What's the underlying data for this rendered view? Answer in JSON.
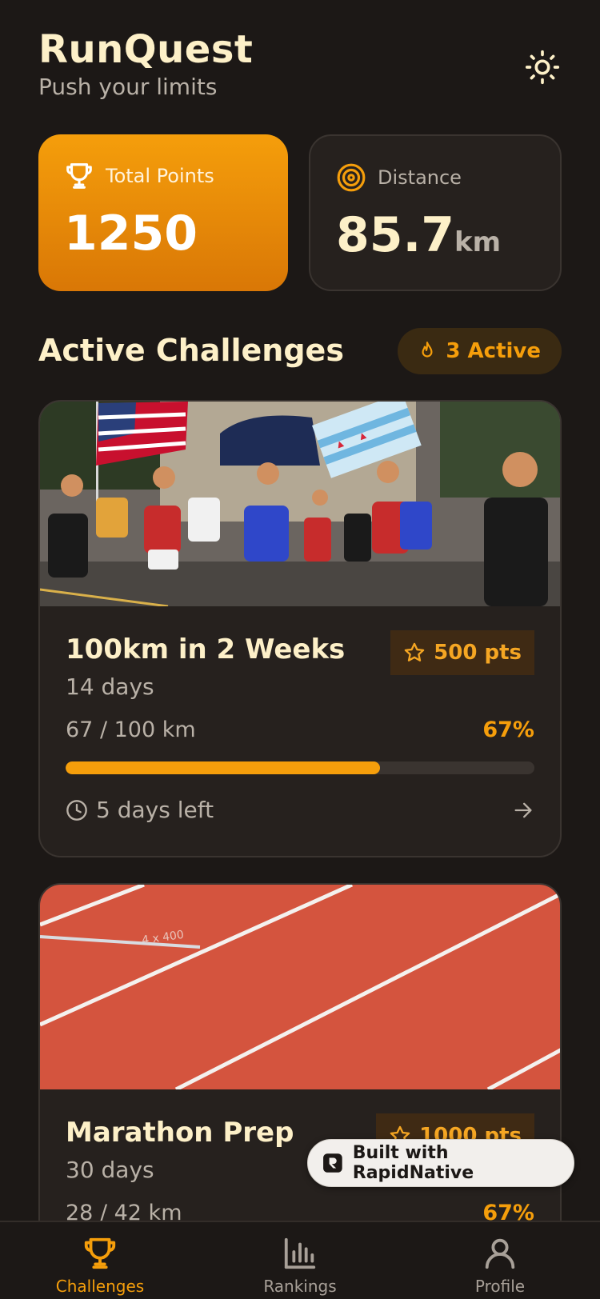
{
  "header": {
    "title": "RunQuest",
    "subtitle": "Push your limits",
    "theme_icon": "sun-icon"
  },
  "stats": {
    "points": {
      "label": "Total Points",
      "value": "1250",
      "icon": "trophy-icon"
    },
    "distance": {
      "label": "Distance",
      "value": "85.7",
      "unit": "km",
      "icon": "target-icon"
    }
  },
  "section": {
    "title": "Active Challenges",
    "badge": "3 Active",
    "badge_icon": "flame-icon"
  },
  "challenges": [
    {
      "title": "100km in 2 Weeks",
      "duration": "14 days",
      "points": "500 pts",
      "progress_text": "67 / 100 km",
      "progress_pct": "67%",
      "progress": 0.67,
      "days_left": "5 days left",
      "image": "marathon-runners-photo"
    },
    {
      "title": "Marathon Prep",
      "duration": "30 days",
      "points": "1000 pts",
      "progress_text": "28 / 42 km",
      "progress_pct": "67%",
      "progress": 0.67,
      "image": "running-track-photo"
    }
  ],
  "built_badge": "Built with RapidNative",
  "tabs": [
    {
      "label": "Challenges",
      "icon": "trophy-icon",
      "active": true
    },
    {
      "label": "Rankings",
      "icon": "bar-chart-icon",
      "active": false
    },
    {
      "label": "Profile",
      "icon": "user-icon",
      "active": false
    }
  ],
  "colors": {
    "accent": "#f59e0b",
    "background": "#1c1816",
    "card": "#26211e",
    "text_primary": "#fdf0c8",
    "text_secondary": "#b9b1a7"
  }
}
